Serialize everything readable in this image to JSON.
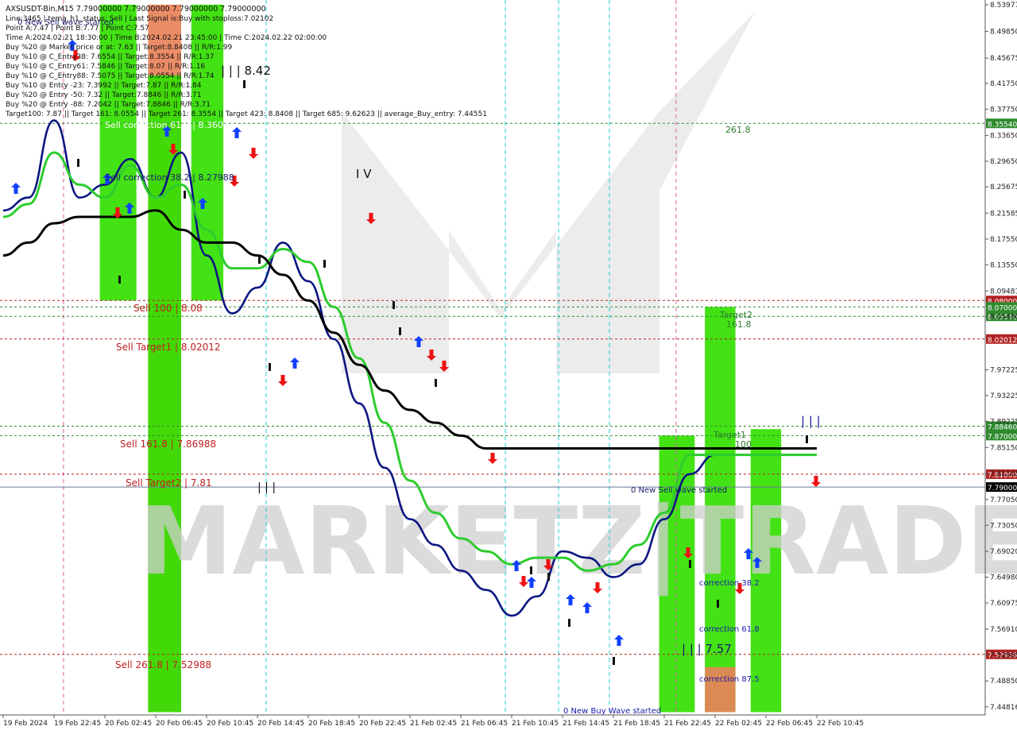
{
  "header": {
    "symbol_line": "AXSUSDT-Bin,M15  7.79000000 7.79000000 7.79000000 7.79000000",
    "info_lines": [
      "Line:3465 | tema_h1_status: Sell | Last Signal is:Buy with stoploss:7.02102",
      "Point A:7.47 | Point B:7.77 | Point C:7.57",
      "Time A:2024.02.21 18:30:00 | Time B:2024.02.21 23:45:00 | Time C:2024.02.22 02:00:00",
      "Buy %20 @ Market price or at: 7.63 || Target:8.8408 || R/R:1.99",
      "Buy %10 @ C_Entry38: 7.6554 || Target:8.3554 || R/R:1.37",
      "Buy %10 @ C_Entry61: 7.5846 || Target:8.07 || R/R:1.16",
      "Buy %10 @ C_Entry88: 7.5075 || Target:8.0554 || R/R:1.74",
      "Buy %10 @ Entry -23: 7.3992 || Target:7.87 || R/R:1.84",
      "Buy %20 @ Entry -50: 7.32 || Target:7.8846 || R/R:3.71",
      "Buy %20 @ Entry -88: 7.2042 || Target:7.8846 || R/R:3.71",
      "Target100: 7.87 || Target 161: 8.0554 || Target 261: 8.3554 || Target 423: 8.8408 || Target 685: 9.62623 || average_Buy_entry: 7.44551"
    ]
  },
  "annotations": {
    "new_sell_wave_top": "0 New Sell wave started",
    "iii_842": "| | | 8.42",
    "sell_corr_618": "Sell correction 61.8 | 8.36012",
    "sell_corr_382": "Sell correction 38.2 | 8.27988",
    "iv": "I V",
    "sell_100": "Sell 100 | 8.08",
    "sell_target1": "Sell Target1 | 8.02012",
    "sell_1618": "Sell 161.8 | 7.86988",
    "sell_target2": "Sell Target2 | 7.81",
    "iii_mid": "| | |",
    "sell_2618": "Sell 261.8 | 7.52988",
    "new_sell_wave_mid": "0 New Sell wave started",
    "new_buy_wave": "0 New Buy Wave started",
    "corr_382": "correction 38.2",
    "corr_618": "correction 61.8",
    "corr_875": "correction 87.5",
    "iii_757": "| | | 7.57",
    "target2": "Target2",
    "t1618": "161.8",
    "target1": "Target1",
    "t100": "100",
    "t2618": "261.8",
    "iii_right": "| | |"
  },
  "watermark": "MARKETZ|TRADE",
  "colors": {
    "ma_fast": "#0b1680",
    "ma_mid": "#2ecc2e",
    "ma_slow": "#000000",
    "zone_green": "#33e000",
    "zone_orange": "#e8825a",
    "buy_arrow": "#1040ff",
    "sell_arrow": "#ee1111",
    "green_level": "#2e8b2e",
    "red_level": "#b22222",
    "price_line": "#6a7b98"
  },
  "chart_data": {
    "type": "line",
    "title": "AXSUSDT-Bin,M15",
    "ylim": [
      7.44186,
      8.53977
    ],
    "y_ticks": [
      "8.53977",
      "8.49850",
      "8.45675",
      "8.41750",
      "8.37750",
      "8.33650",
      "8.29650",
      "8.25675",
      "8.21585",
      "8.17550",
      "8.13550",
      "8.09481",
      "8.05480",
      "7.97225",
      "7.93225",
      "7.89225",
      "7.85150",
      "7.81105",
      "7.77050",
      "7.73050",
      "7.69020",
      "7.64980",
      "7.60975",
      "7.56910",
      "7.52905",
      "7.48850",
      "7.44816"
    ],
    "x_ticks": [
      "19 Feb 2024",
      "19 Feb 22:45",
      "20 Feb 02:45",
      "20 Feb 06:45",
      "20 Feb 10:45",
      "20 Feb 14:45",
      "20 Feb 18:45",
      "20 Feb 22:45",
      "21 Feb 02:45",
      "21 Feb 06:45",
      "21 Feb 10:45",
      "21 Feb 14:45",
      "21 Feb 18:45",
      "21 Feb 22:45",
      "22 Feb 02:45",
      "22 Feb 06:45",
      "22 Feb 10:45"
    ],
    "price_levels": [
      {
        "label": "8.35540",
        "value": 8.3554,
        "style": "green"
      },
      {
        "label": "8.08000",
        "value": 8.08,
        "style": "red"
      },
      {
        "label": "8.07000",
        "value": 8.07,
        "style": "green"
      },
      {
        "label": "8.05540",
        "value": 8.0554,
        "style": "green"
      },
      {
        "label": "8.02012",
        "value": 8.02012,
        "style": "red"
      },
      {
        "label": "7.88460",
        "value": 7.8846,
        "style": "green"
      },
      {
        "label": "7.87000",
        "value": 7.87,
        "style": "green"
      },
      {
        "label": "7.81000",
        "value": 7.81,
        "style": "red"
      },
      {
        "label": "7.79000",
        "value": 7.79,
        "style": "current"
      },
      {
        "label": "7.52988",
        "value": 7.52988,
        "style": "red"
      }
    ],
    "series": [
      {
        "color_key": "ma_fast",
        "x": [
          0,
          0.5,
          1,
          1.5,
          2,
          2.5,
          3,
          3.5,
          4,
          4.5,
          5,
          5.5,
          6,
          6.5,
          7,
          7.5,
          8,
          8.5,
          9,
          9.5,
          10,
          10.5,
          11,
          11.5,
          12,
          12.5,
          13,
          13.5,
          14,
          14.5,
          15,
          15.5,
          16
        ],
        "values": [
          8.22,
          8.24,
          8.36,
          8.24,
          8.26,
          8.3,
          8.24,
          8.31,
          8.15,
          8.06,
          8.1,
          8.17,
          8.11,
          8.02,
          7.92,
          7.82,
          7.74,
          7.7,
          7.66,
          7.63,
          7.59,
          7.62,
          7.69,
          7.68,
          7.65,
          7.67,
          7.74,
          7.81,
          7.84,
          7.84,
          7.84,
          7.84,
          7.84
        ]
      },
      {
        "color_key": "ma_mid",
        "x": [
          0,
          0.5,
          1,
          1.5,
          2,
          2.5,
          3,
          3.5,
          4,
          4.5,
          5,
          5.5,
          6,
          6.5,
          7,
          7.5,
          8,
          8.5,
          9,
          9.5,
          10,
          10.5,
          11,
          11.5,
          12,
          12.5,
          13,
          13.5,
          14,
          14.5,
          15,
          15.5,
          16
        ],
        "values": [
          8.21,
          8.23,
          8.31,
          8.26,
          8.24,
          8.29,
          8.24,
          8.26,
          8.19,
          8.13,
          8.13,
          8.16,
          8.14,
          8.07,
          7.99,
          7.89,
          7.8,
          7.75,
          7.71,
          7.69,
          7.67,
          7.68,
          7.68,
          7.66,
          7.67,
          7.7,
          7.75,
          7.84,
          7.84,
          7.84,
          7.84,
          7.84,
          7.84
        ]
      },
      {
        "color_key": "ma_slow",
        "x": [
          0,
          0.5,
          1,
          1.5,
          2,
          2.5,
          3,
          3.5,
          4,
          4.5,
          5,
          5.5,
          6,
          6.5,
          7,
          7.5,
          8,
          8.5,
          9,
          9.5,
          10,
          10.5,
          11,
          11.5,
          12,
          12.5,
          13,
          13.5,
          14,
          14.5,
          15,
          15.5,
          16
        ],
        "values": [
          8.15,
          8.17,
          8.2,
          8.21,
          8.21,
          8.21,
          8.22,
          8.19,
          8.17,
          8.17,
          8.15,
          8.12,
          8.08,
          8.03,
          7.98,
          7.94,
          7.91,
          7.89,
          7.87,
          7.85,
          7.85,
          7.85,
          7.85,
          7.85,
          7.85,
          7.85,
          7.85,
          7.85,
          7.85,
          7.85,
          7.85,
          7.85,
          7.85
        ]
      }
    ],
    "zones": [
      {
        "color_key": "zone_green",
        "x0": 1.9,
        "x1": 2.62,
        "y0": 8.08,
        "y1": 8.54
      },
      {
        "color_key": "zone_orange",
        "x0": 2.85,
        "x1": 3.5,
        "y0": 7.44,
        "y1": 8.54
      },
      {
        "color_key": "zone_green",
        "x0": 2.85,
        "x1": 3.5,
        "y0": 7.44,
        "y1": 8.43
      },
      {
        "color_key": "zone_green",
        "x0": 3.7,
        "x1": 4.33,
        "y0": 8.08,
        "y1": 8.54
      },
      {
        "color_key": "zone_green",
        "x0": 12.9,
        "x1": 13.6,
        "y0": 7.44,
        "y1": 7.87
      },
      {
        "color_key": "zone_green",
        "x0": 13.8,
        "x1": 14.4,
        "y0": 7.44,
        "y1": 8.07
      },
      {
        "color_key": "zone_orange",
        "x0": 13.8,
        "x1": 14.4,
        "y0": 7.44,
        "y1": 7.51
      },
      {
        "color_key": "zone_green",
        "x0": 14.7,
        "x1": 15.3,
        "y0": 7.44,
        "y1": 7.88
      }
    ]
  }
}
